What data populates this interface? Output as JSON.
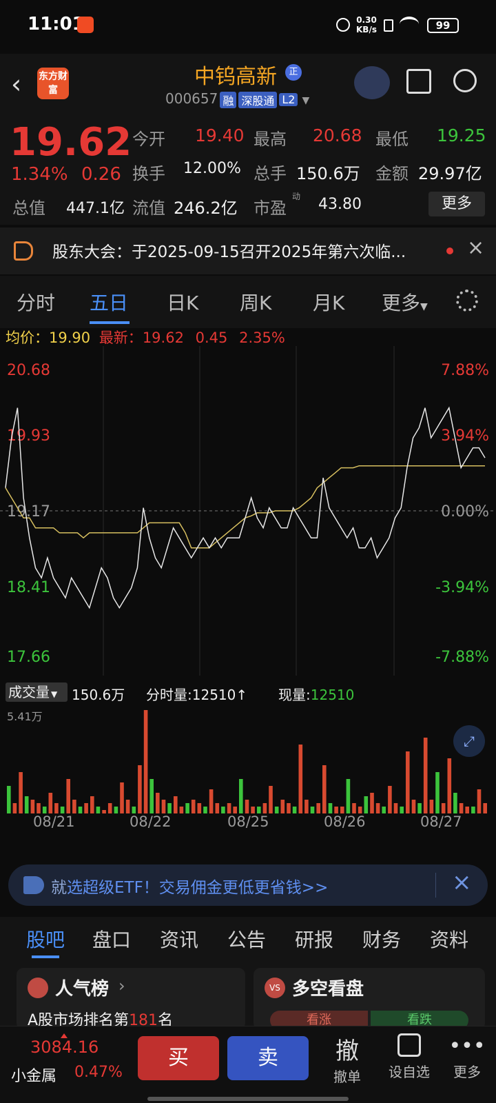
{
  "status": {
    "time": "11:01",
    "net_speed": "0.30",
    "net_unit": "KB/s",
    "battery": "99"
  },
  "header": {
    "stock_name": "中钨高新",
    "zheng": "正",
    "code": "000657",
    "tags": [
      "融",
      "深股通",
      "L2"
    ],
    "app_logo": "东方财富"
  },
  "quote": {
    "price": "19.62",
    "change_pct": "1.34%",
    "change": "0.26",
    "open_label": "今开",
    "open": "19.40",
    "high_label": "最高",
    "high": "20.68",
    "low_label": "最低",
    "low": "19.25",
    "turnover_label": "换手",
    "turnover": "12.00%",
    "volume_label": "总手",
    "volume": "150.6万",
    "amount_label": "金额",
    "amount": "29.97亿",
    "mcap_label": "总值",
    "mcap": "447.1亿",
    "float_label": "流值",
    "float": "246.2亿",
    "pe_label": "市盈",
    "pe_sup": "动",
    "pe": "43.80",
    "more": "更多"
  },
  "notice": {
    "text": "股东大会：于2025-09-15召开2025年第六次临..."
  },
  "tabs": {
    "t1": "分时",
    "t2": "五日",
    "t3": "日K",
    "t4": "周K",
    "t5": "月K",
    "t6": "更多"
  },
  "chart_info": {
    "avg_label": "均价：",
    "avg": "19.90",
    "last_label": "最新：",
    "last": "19.62",
    "chg": "0.45",
    "chg_pct": "2.35%"
  },
  "chart_data": {
    "type": "line",
    "y_left": [
      "20.68",
      "19.93",
      "19.17",
      "18.41",
      "17.66"
    ],
    "y_right": [
      "7.88%",
      "3.94%",
      "0.00%",
      "-3.94%",
      "-7.88%"
    ],
    "ylim": [
      17.66,
      20.68
    ],
    "days": [
      "08/21",
      "08/22",
      "08/25",
      "08/26",
      "08/27"
    ],
    "series": [
      {
        "values": [
          19.4,
          19.9,
          20.2,
          19.3,
          18.9,
          18.6,
          18.5,
          18.7,
          18.5,
          18.4,
          18.3,
          18.5,
          18.4,
          18.3,
          18.2,
          18.4,
          18.6,
          18.5,
          18.3,
          18.2,
          18.3,
          18.4,
          18.6,
          19.2,
          18.9,
          18.7,
          18.6,
          18.8,
          19.0,
          18.9,
          18.8,
          18.7,
          18.8,
          18.9,
          18.8,
          18.9,
          18.8,
          18.9,
          18.9,
          18.9,
          19.1,
          19.3,
          19.1,
          19.0,
          19.2,
          19.1,
          19.0,
          19.0,
          19.2,
          19.1,
          19.0,
          18.9,
          18.9,
          19.5,
          19.2,
          19.1,
          19.0,
          18.9,
          19.0,
          18.8,
          18.8,
          18.9,
          18.7,
          18.8,
          18.9,
          19.1,
          19.2,
          19.6,
          19.9,
          20.0,
          20.2,
          19.9,
          20.0,
          20.1,
          20.2,
          19.9,
          19.6,
          19.7,
          19.8,
          19.8,
          19.7
        ]
      },
      {
        "values": [
          19.4,
          19.3,
          19.2,
          19.1,
          19.1,
          19.0,
          19.0,
          19.0,
          19.0,
          18.95,
          18.95,
          18.95,
          18.95,
          18.9,
          18.95,
          18.95,
          18.95,
          18.95,
          18.95,
          18.95,
          18.95,
          18.95,
          18.95,
          19.0,
          19.05,
          19.05,
          19.05,
          19.05,
          19.05,
          19.05,
          18.95,
          18.8,
          18.8,
          18.8,
          18.8,
          18.85,
          18.9,
          18.95,
          19.0,
          19.05,
          19.1,
          19.12,
          19.15,
          19.15,
          19.15,
          19.17,
          19.17,
          19.17,
          19.17,
          19.2,
          19.25,
          19.3,
          19.4,
          19.45,
          19.5,
          19.55,
          19.6,
          19.6,
          19.6,
          19.62,
          19.62,
          19.62,
          19.62,
          19.62,
          19.62,
          19.62,
          19.62,
          19.62,
          19.62,
          19.62,
          19.62,
          19.62,
          19.62,
          19.62,
          19.62,
          19.62,
          19.62,
          19.62,
          19.62,
          19.62,
          19.62
        ]
      }
    ],
    "volume": [
      8,
      3,
      12,
      5,
      4,
      3,
      2,
      6,
      3,
      2,
      10,
      4,
      2,
      3,
      5,
      2,
      1,
      3,
      2,
      9,
      4,
      2,
      14,
      30,
      10,
      6,
      4,
      3,
      5,
      2,
      3,
      4,
      3,
      2,
      7,
      3,
      2,
      3,
      2,
      10,
      4,
      2,
      2,
      3,
      8,
      2,
      4,
      3,
      2,
      20,
      4,
      2,
      3,
      14,
      3,
      2,
      2,
      10,
      3,
      2,
      5,
      6,
      3,
      2,
      8,
      3,
      2,
      18,
      4,
      3,
      22,
      4,
      12,
      3,
      16,
      6,
      3,
      2,
      2,
      7,
      3
    ]
  },
  "chart_labels": {
    "volume_sel": "成交量",
    "volume_total": "150.6万",
    "tick_label": "分时量:",
    "tick_val": "12510",
    "tick_arrow": "↑",
    "now_label": "现量:",
    "now_val": "12510",
    "vol_max": "5.41万"
  },
  "ad": {
    "text1": "就",
    "text2": "选超级ETF！交易佣金更低更省钱>>"
  },
  "sub_tabs": {
    "s1": "股吧",
    "s2": "盘口",
    "s3": "资讯",
    "s4": "公告",
    "s5": "研报",
    "s6": "财务",
    "s7": "资料"
  },
  "cards": {
    "c1_title": "人气榜",
    "c1_text_a": "A股市场排名第",
    "c1_rank": "181",
    "c1_text_b": "名",
    "c2_title": "多空看盘",
    "c2_up": "看涨",
    "c2_down": "看跌"
  },
  "bottom": {
    "index_val": "3084.16",
    "index_name": "小金属",
    "index_pct": "0.47%",
    "buy": "买",
    "sell": "卖",
    "cancel_icon": "撤",
    "cancel": "撤单",
    "custom": "设自选",
    "more": "更多"
  }
}
